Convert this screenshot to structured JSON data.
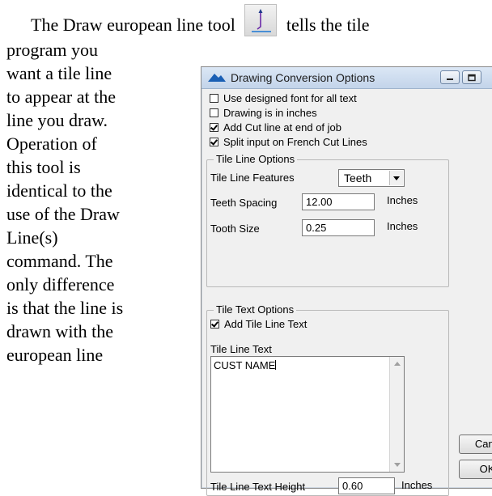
{
  "document": {
    "line1_before": "The Draw european line tool",
    "line1_after": "tells the tile",
    "wrapped_lines": [
      "program you",
      "want a tile line",
      "to appear at the",
      "line you draw.",
      "Operation of",
      "this tool is",
      "identical to the",
      "use of the Draw",
      "Line(s)",
      "command.  The",
      "only difference",
      "is that the line is",
      "drawn with the",
      "european line"
    ]
  },
  "dialog": {
    "title": "Drawing Conversion Options",
    "checkboxes": [
      {
        "label": "Use designed font for all text",
        "checked": false
      },
      {
        "label": "Drawing is in inches",
        "checked": false
      },
      {
        "label": "Add Cut line at end of job",
        "checked": true
      },
      {
        "label": "Split input on French Cut Lines",
        "checked": true
      }
    ],
    "tile_line_options": {
      "group_title": "Tile Line Options",
      "features_label": "Tile Line Features",
      "features_value": "Teeth",
      "spacing_label": "Teeth Spacing",
      "spacing_value": "12.00",
      "spacing_unit": "Inches",
      "size_label": "Tooth Size",
      "size_value": "0.25",
      "size_unit": "Inches"
    },
    "tile_text_options": {
      "group_title": "Tile Text Options",
      "add_text_label": "Add Tile Line Text",
      "add_text_checked": true,
      "text_label": "Tile Line Text",
      "text_value": "CUST NAME",
      "height_label": "Tile Line Text Height",
      "height_value": "0.60",
      "height_unit": "Inches"
    },
    "buttons": {
      "cancel": "Canc",
      "ok": "OK"
    }
  }
}
